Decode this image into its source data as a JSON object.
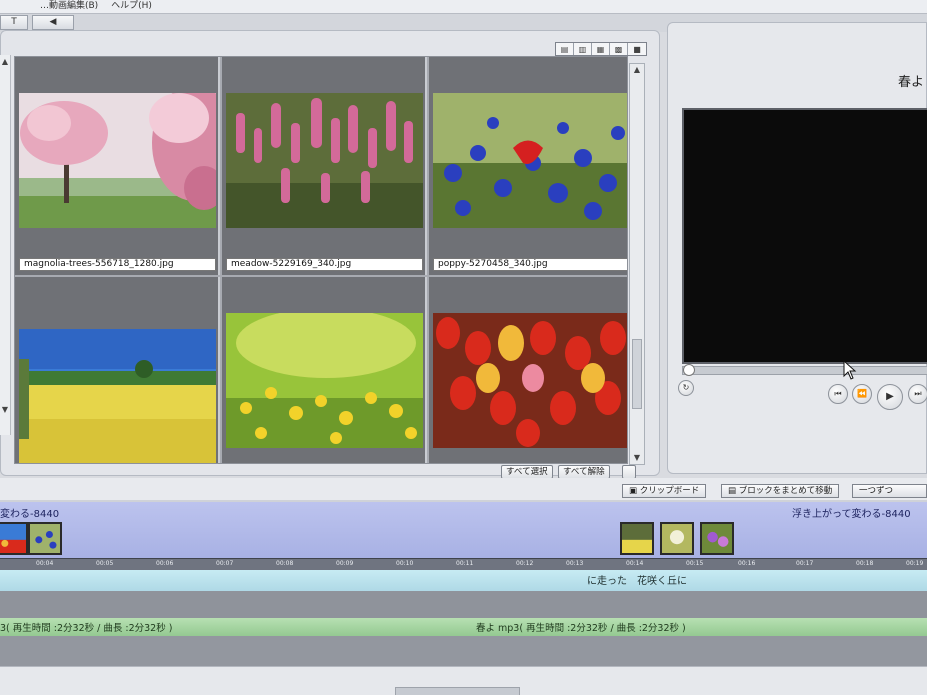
{
  "menubar": {
    "left_text": "…動画編集(B)",
    "help": "ヘルプ(H)"
  },
  "toolbar": {
    "text_tool": "T",
    "sound_tool": "◀"
  },
  "gallery": {
    "view_modes": [
      "list-icon",
      "details-icon",
      "small-grid-icon",
      "medium-grid-icon",
      "large-icon"
    ],
    "items": [
      {
        "filename": "magnolia-trees-556718_1280.jpg",
        "scene": "magnolia"
      },
      {
        "filename": "meadow-5229169_340.jpg",
        "scene": "meadow"
      },
      {
        "filename": "poppy-5270458_340.jpg",
        "scene": "poppy"
      },
      {
        "filename": "",
        "scene": "rapeseed"
      },
      {
        "filename": "",
        "scene": "green"
      },
      {
        "filename": "",
        "scene": "tulips"
      }
    ],
    "select_all": "すべて選択",
    "deselect_all": "すべて解除"
  },
  "preview": {
    "title": "春よ"
  },
  "clipboard": {
    "clipboard_label": "クリップボード",
    "move_block_label": "ブロックをまとめて移動",
    "next_label": "一つずつ"
  },
  "timeline": {
    "track1_left_label": "変わる-8440",
    "track1_right_label": "浮き上がって変わる-8440",
    "ruler_ticks": [
      "00:04",
      "00:05",
      "00:06",
      "00:07",
      "00:08",
      "00:09",
      "00:10",
      "00:11",
      "00:12",
      "00:13",
      "00:14",
      "00:15",
      "00:16",
      "00:17",
      "00:18",
      "00:19"
    ],
    "lyric": "に走った　花咲く丘に",
    "music_left": "3( 再生時間 :2分32秒 / 曲長 :2分32秒 )",
    "music_right": "春よ mp3( 再生時間 :2分32秒 / 曲長 :2分32秒 )"
  },
  "colors": {
    "track_blue": "#a8b1e4",
    "lyric_cyan": "#afd9e6",
    "music_green": "#94c991",
    "preview_black": "#0b0b0b"
  }
}
